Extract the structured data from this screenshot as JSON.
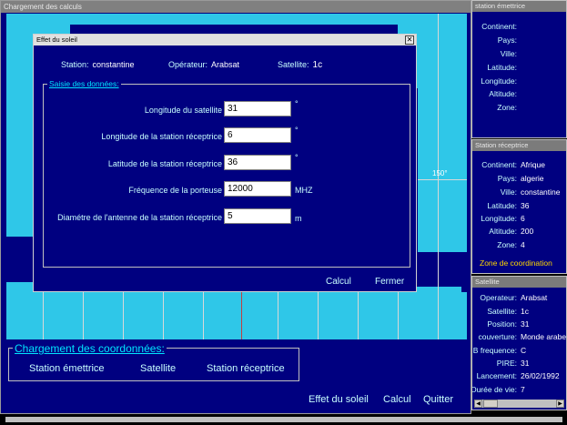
{
  "main": {
    "title": "Chargement des calculs",
    "map_label_150": "150°",
    "coord_group": {
      "title": "Chargement des coordonnées:",
      "buttons": [
        "Station émettrice",
        "Satellite",
        "Station réceptrice"
      ]
    },
    "bottom_buttons": [
      "Effet du soleil",
      "Calcul",
      "Quitter"
    ]
  },
  "station_emettrice": {
    "title": "station émettrice",
    "fields": [
      {
        "label": "Continent:",
        "value": ""
      },
      {
        "label": "Pays:",
        "value": ""
      },
      {
        "label": "Ville:",
        "value": ""
      },
      {
        "label": "Latitude:",
        "value": ""
      },
      {
        "label": "Longitude:",
        "value": ""
      },
      {
        "label": "Altitude:",
        "value": ""
      },
      {
        "label": "Zone:",
        "value": ""
      }
    ]
  },
  "station_receptrice": {
    "title": "Station réceptrice",
    "fields": [
      {
        "label": "Continent:",
        "value": "Afrique"
      },
      {
        "label": "Pays:",
        "value": "algerie"
      },
      {
        "label": "Ville:",
        "value": "constantine"
      },
      {
        "label": "Latitude:",
        "value": "36"
      },
      {
        "label": "Longitude:",
        "value": "6"
      },
      {
        "label": "Altitude:",
        "value": "200"
      },
      {
        "label": "Zone:",
        "value": "4"
      }
    ],
    "zone_coordination": "Zone de coordination"
  },
  "satellite_panel": {
    "title": "Satellite",
    "fields": [
      {
        "label": "Operateur:",
        "value": "Arabsat"
      },
      {
        "label": "Satellite:",
        "value": "1c"
      },
      {
        "label": "Position:",
        "value": "31"
      },
      {
        "label": "couverture:",
        "value": "Monde arabe"
      },
      {
        "label": "B frequence:",
        "value": "C"
      },
      {
        "label": "PIRE:",
        "value": "31"
      },
      {
        "label": "Lancement:",
        "value": "26/02/1992"
      },
      {
        "label": "Durée de vie:",
        "value": "7"
      }
    ]
  },
  "dialog": {
    "title": "Effet du soleil",
    "close_glyph": "✕",
    "station_label": "Station:",
    "station_value": "constantine",
    "operateur_label": "Opérateur:",
    "operateur_value": "Arabsat",
    "satellite_label": "Satellite:",
    "satellite_value": "1c",
    "group_title": "Saisie des données:",
    "fields": [
      {
        "label": "Longitude du satellite",
        "value": "31",
        "unit": "°"
      },
      {
        "label": "Longitude de la station réceptrice",
        "value": "6",
        "unit": "°"
      },
      {
        "label": "Latitude de la station réceptrice",
        "value": "36",
        "unit": "°"
      },
      {
        "label": "Fréquence de la porteuse",
        "value": "12000",
        "unit": "MHZ"
      },
      {
        "label": "Diamétre de l'antenne de la station réceptrice",
        "value": "5",
        "unit": "m"
      }
    ],
    "buttons": {
      "calcul": "Calcul",
      "fermer": "Fermer"
    }
  },
  "colors": {
    "window_bg": "#000080",
    "land": "#2fc7e8",
    "label_text": "#c8ffff",
    "legend_text": "#00e5ff",
    "highlight": "#ffd700"
  }
}
